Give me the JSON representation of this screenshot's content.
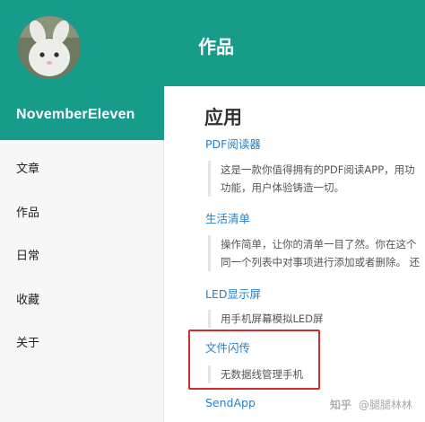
{
  "sidebar": {
    "site_name": "NovemberEleven",
    "nav": [
      {
        "label": "文章"
      },
      {
        "label": "作品"
      },
      {
        "label": "日常"
      },
      {
        "label": "收藏"
      },
      {
        "label": "关于"
      }
    ]
  },
  "header": {
    "title": "作品"
  },
  "main": {
    "section_title": "应用",
    "apps": [
      {
        "name": "PDF阅读器",
        "desc_lines": [
          "这是一款你值得拥有的PDF阅读APP，用功",
          "功能，用户体验铸造一切。"
        ]
      },
      {
        "name": "生活清单",
        "desc_lines": [
          "操作简单，让你的清单一目了然。你在这个",
          "同一个列表中对事项进行添加或者删除。 还"
        ]
      },
      {
        "name": "LED显示屏",
        "desc_lines": [
          "用手机屏幕模拟LED屏"
        ]
      },
      {
        "name": "文件闪传",
        "desc_lines": [
          "无数据线管理手机"
        ]
      },
      {
        "name": "SendApp",
        "desc_lines": []
      }
    ]
  },
  "watermark": {
    "icon": "知乎",
    "text": "@腿腿林林"
  },
  "colors": {
    "brand": "#179b8a",
    "link": "#2d7fc0",
    "highlight": "#d42a2a"
  }
}
